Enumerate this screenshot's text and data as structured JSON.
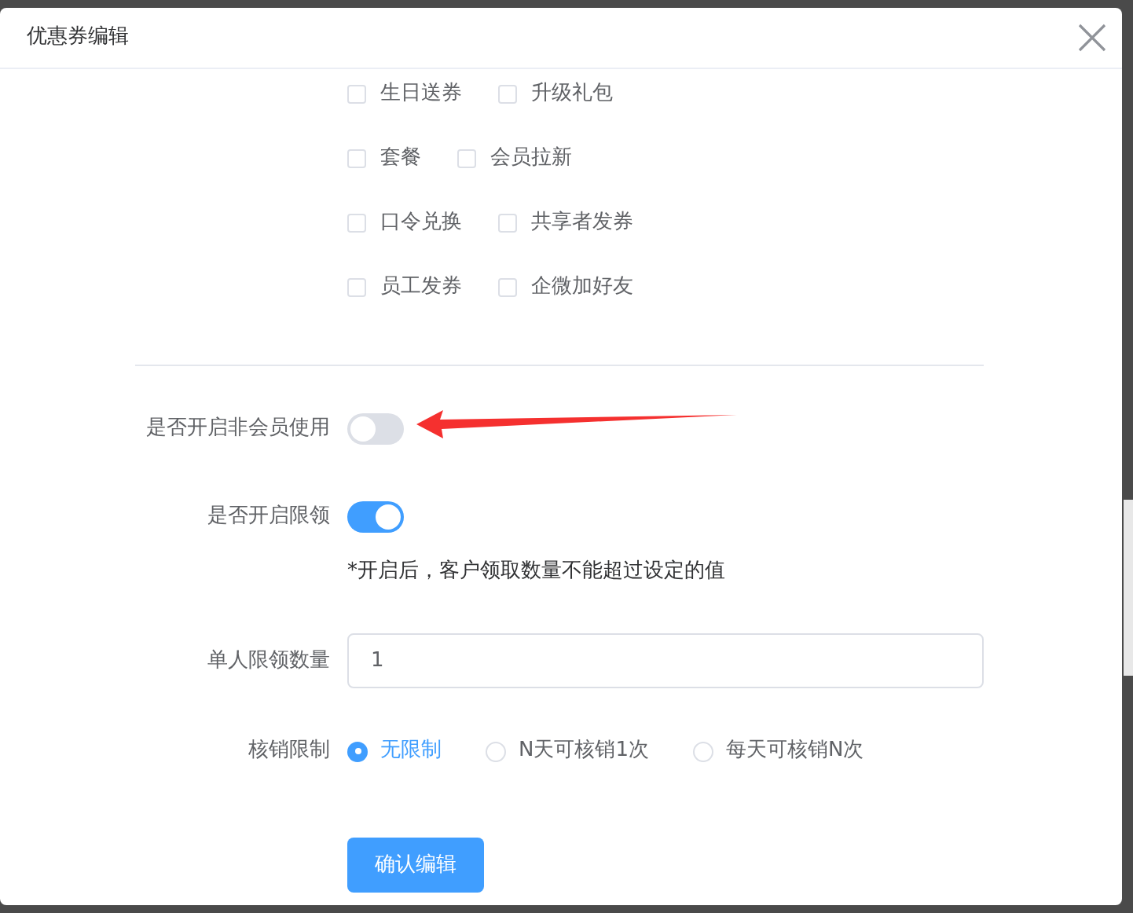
{
  "dialog": {
    "title": "优惠券编辑"
  },
  "checkbox_rows": [
    {
      "items": [
        {
          "label": "生日送券",
          "checked": false
        },
        {
          "label": "升级礼包",
          "checked": false
        }
      ]
    },
    {
      "items": [
        {
          "label": "套餐",
          "checked": false
        },
        {
          "label": "会员拉新",
          "checked": false
        }
      ]
    },
    {
      "items": [
        {
          "label": "口令兑换",
          "checked": false
        },
        {
          "label": "共享者发券",
          "checked": false
        }
      ]
    },
    {
      "items": [
        {
          "label": "员工发券",
          "checked": false
        },
        {
          "label": "企微加好友",
          "checked": false
        }
      ]
    }
  ],
  "settings": [
    {
      "kind": "toggle",
      "label": "是否开启非会员使用",
      "on": false
    },
    {
      "kind": "toggle",
      "label": "是否开启限领",
      "on": true,
      "note": "*开启后，客户领取数量不能超过设定的值"
    },
    {
      "kind": "input",
      "label": "单人限领数量",
      "value": "1"
    },
    {
      "kind": "radio",
      "label": "核销限制",
      "options": [
        {
          "label": "无限制",
          "selected": true
        },
        {
          "label": "N天可核销1次",
          "selected": false
        },
        {
          "label": "每天可核销N次",
          "selected": false
        }
      ]
    }
  ],
  "confirm_button": "确认编辑"
}
